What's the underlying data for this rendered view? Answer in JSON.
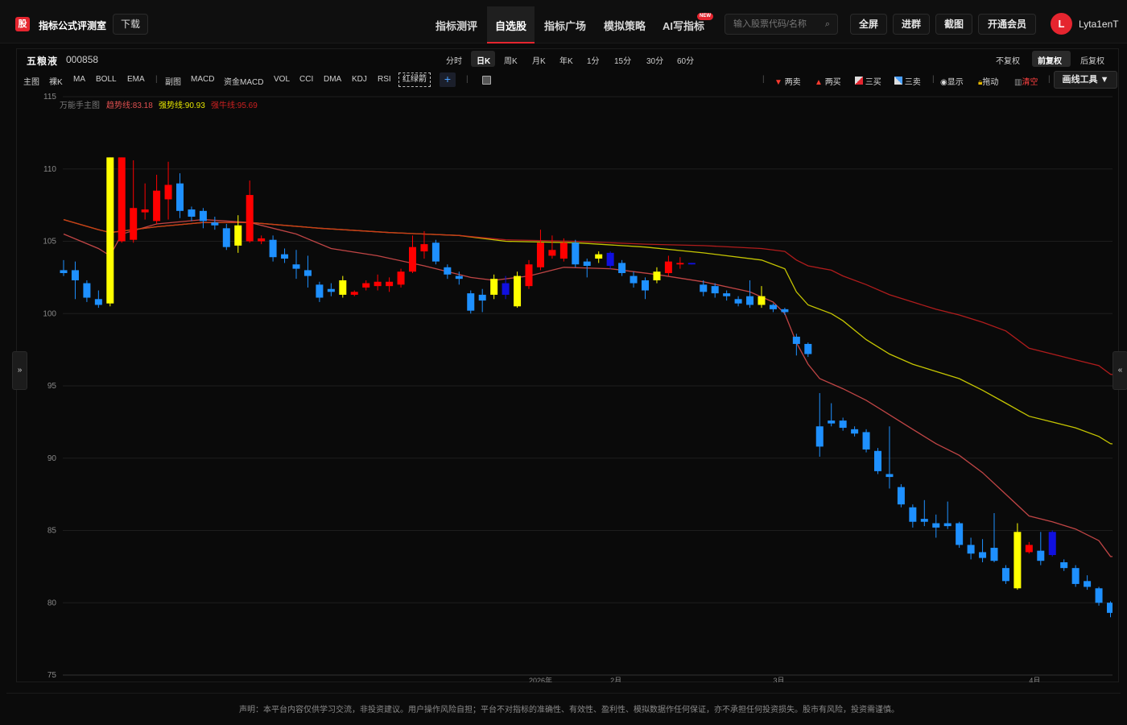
{
  "header": {
    "logo_char": "股",
    "brand": "指标公式评测室",
    "download_label": "下载",
    "nav": [
      "指标测评",
      "自选股",
      "指标广场",
      "模拟策略",
      "AI写指标"
    ],
    "nav_active": "自选股",
    "new_badge": "NEW",
    "search_placeholder": "输入股票代码/名称",
    "buttons": [
      "全屏",
      "进群",
      "截图",
      "开通会员"
    ],
    "avatar_letter": "L",
    "username": "Lyta1enT"
  },
  "stock": {
    "name": "五粮液",
    "code": "000858"
  },
  "periods": [
    "分时",
    "日K",
    "周K",
    "月K",
    "年K",
    "1分",
    "15分",
    "30分",
    "60分"
  ],
  "period_active": "日K",
  "adjust": [
    "不复权",
    "前复权",
    "后复权"
  ],
  "adjust_active": "前复权",
  "indicators": [
    "主图",
    "裸K",
    "MA",
    "BOLL",
    "EMA",
    "副图",
    "MACD",
    "资金MACD",
    "VOL",
    "CCI",
    "DMA",
    "KDJ",
    "RSI"
  ],
  "indicator_selected": "红绿箭",
  "tools": [
    "两卖",
    "两买",
    "三买",
    "三卖",
    "显示",
    "拖动",
    "清空"
  ],
  "draw_tools_label": "画线工具 ▼",
  "side_left": "»",
  "side_right": "«",
  "footer": "声明：本平台内容仅供学习交流，非投资建议。用户操作风险自担；平台不对指标的准确性、有效性、盈利性、模拟数据作任何保证，亦不承担任何投资损失。股市有风险，投资需谨慎。",
  "colors": {
    "up": "#ff0000",
    "down": "#1e90ff",
    "signal": "#ffff00",
    "dark_blue": "#1010e0",
    "accent": "#e5252f"
  },
  "chart_data": {
    "type": "candlestick",
    "legend": [
      {
        "name": "万能手主图",
        "value": "",
        "color": "#777777"
      },
      {
        "name": "趋势线",
        "value": "83.18",
        "color": "#e05050"
      },
      {
        "name": "强势线",
        "value": "90.93",
        "color": "#e6e600"
      },
      {
        "name": "强牛线",
        "value": "95.69",
        "color": "#cc2020"
      }
    ],
    "ylim": [
      75,
      115
    ],
    "y_ticks": [
      75,
      80,
      85,
      90,
      95,
      100,
      105,
      110,
      115
    ],
    "x_labels": [
      {
        "index": 40,
        "label": "2026年"
      },
      {
        "index": 47,
        "label": "2月"
      },
      {
        "index": 61,
        "label": "3月"
      },
      {
        "index": 83,
        "label": "4月"
      }
    ],
    "candles": [
      {
        "o": 103.0,
        "c": 102.8,
        "h": 103.7,
        "l": 102.6,
        "t": "down"
      },
      {
        "o": 103.0,
        "c": 102.3,
        "h": 103.6,
        "l": 101.0,
        "t": "down"
      },
      {
        "o": 102.1,
        "c": 101.1,
        "h": 102.3,
        "l": 100.8,
        "t": "down"
      },
      {
        "o": 101.0,
        "c": 100.6,
        "h": 101.6,
        "l": 100.4,
        "t": "down"
      },
      {
        "o": 100.7,
        "c": 110.8,
        "h": 110.8,
        "l": 100.5,
        "t": "signal"
      },
      {
        "o": 105.0,
        "c": 110.8,
        "h": 110.8,
        "l": 104.9,
        "t": "up"
      },
      {
        "o": 105.1,
        "c": 107.3,
        "h": 110.6,
        "l": 104.9,
        "t": "up"
      },
      {
        "o": 107.0,
        "c": 107.2,
        "h": 109.0,
        "l": 106.5,
        "t": "up"
      },
      {
        "o": 106.4,
        "c": 108.5,
        "h": 109.6,
        "l": 106.2,
        "t": "up"
      },
      {
        "o": 107.9,
        "c": 108.9,
        "h": 110.5,
        "l": 106.5,
        "t": "up"
      },
      {
        "o": 109.0,
        "c": 107.1,
        "h": 109.7,
        "l": 106.6,
        "t": "down"
      },
      {
        "o": 107.2,
        "c": 106.7,
        "h": 107.4,
        "l": 106.4,
        "t": "down"
      },
      {
        "o": 107.1,
        "c": 106.4,
        "h": 107.3,
        "l": 105.9,
        "t": "down"
      },
      {
        "o": 106.3,
        "c": 106.1,
        "h": 106.7,
        "l": 105.8,
        "t": "down"
      },
      {
        "o": 105.9,
        "c": 104.6,
        "h": 106.2,
        "l": 104.4,
        "t": "down"
      },
      {
        "o": 104.7,
        "c": 106.1,
        "h": 106.8,
        "l": 104.2,
        "t": "signal"
      },
      {
        "o": 105.0,
        "c": 108.2,
        "h": 109.2,
        "l": 104.9,
        "t": "up"
      },
      {
        "o": 105.2,
        "c": 105.0,
        "h": 105.4,
        "l": 104.8,
        "t": "up"
      },
      {
        "o": 105.1,
        "c": 103.9,
        "h": 105.4,
        "l": 103.6,
        "t": "down"
      },
      {
        "o": 104.1,
        "c": 103.8,
        "h": 104.5,
        "l": 103.5,
        "t": "down"
      },
      {
        "o": 103.4,
        "c": 103.1,
        "h": 104.4,
        "l": 102.4,
        "t": "down"
      },
      {
        "o": 103.0,
        "c": 102.6,
        "h": 104.0,
        "l": 101.8,
        "t": "down"
      },
      {
        "o": 102.0,
        "c": 101.1,
        "h": 102.2,
        "l": 100.8,
        "t": "down"
      },
      {
        "o": 101.7,
        "c": 101.5,
        "h": 102.1,
        "l": 101.2,
        "t": "down"
      },
      {
        "o": 101.3,
        "c": 102.3,
        "h": 102.6,
        "l": 101.1,
        "t": "signal"
      },
      {
        "o": 101.5,
        "c": 101.3,
        "h": 101.6,
        "l": 101.2,
        "t": "up"
      },
      {
        "o": 101.8,
        "c": 102.1,
        "h": 102.3,
        "l": 101.6,
        "t": "up"
      },
      {
        "o": 101.9,
        "c": 102.2,
        "h": 102.7,
        "l": 101.6,
        "t": "up"
      },
      {
        "o": 101.9,
        "c": 102.2,
        "h": 102.5,
        "l": 101.5,
        "t": "up"
      },
      {
        "o": 102.0,
        "c": 102.9,
        "h": 103.1,
        "l": 101.8,
        "t": "up"
      },
      {
        "o": 102.9,
        "c": 104.6,
        "h": 105.4,
        "l": 102.8,
        "t": "up"
      },
      {
        "o": 104.3,
        "c": 104.8,
        "h": 105.7,
        "l": 103.8,
        "t": "up"
      },
      {
        "o": 104.9,
        "c": 103.6,
        "h": 105.1,
        "l": 103.4,
        "t": "down"
      },
      {
        "o": 103.2,
        "c": 102.7,
        "h": 103.4,
        "l": 102.4,
        "t": "down"
      },
      {
        "o": 102.6,
        "c": 102.4,
        "h": 102.9,
        "l": 102.0,
        "t": "down"
      },
      {
        "o": 101.4,
        "c": 100.2,
        "h": 101.6,
        "l": 100.0,
        "t": "down"
      },
      {
        "o": 101.3,
        "c": 100.9,
        "h": 101.7,
        "l": 100.1,
        "t": "down"
      },
      {
        "o": 101.3,
        "c": 102.4,
        "h": 102.7,
        "l": 101.0,
        "t": "signal"
      },
      {
        "o": 101.3,
        "c": 102.1,
        "h": 102.6,
        "l": 101.0,
        "t": "dark_blue"
      },
      {
        "o": 100.5,
        "c": 102.6,
        "h": 102.9,
        "l": 100.4,
        "t": "signal"
      },
      {
        "o": 101.9,
        "c": 103.4,
        "h": 103.7,
        "l": 101.7,
        "t": "up"
      },
      {
        "o": 103.2,
        "c": 104.9,
        "h": 105.8,
        "l": 103.0,
        "t": "up"
      },
      {
        "o": 104.0,
        "c": 104.4,
        "h": 105.4,
        "l": 103.8,
        "t": "up"
      },
      {
        "o": 103.8,
        "c": 104.9,
        "h": 105.2,
        "l": 103.6,
        "t": "up"
      },
      {
        "o": 104.9,
        "c": 103.4,
        "h": 105.1,
        "l": 103.2,
        "t": "down"
      },
      {
        "o": 103.6,
        "c": 103.3,
        "h": 103.8,
        "l": 102.5,
        "t": "down"
      },
      {
        "o": 104.1,
        "c": 103.8,
        "h": 104.3,
        "l": 103.5,
        "t": "signal"
      },
      {
        "o": 103.3,
        "c": 104.2,
        "h": 104.3,
        "l": 103.1,
        "t": "dark_blue"
      },
      {
        "o": 103.5,
        "c": 102.8,
        "h": 103.7,
        "l": 102.6,
        "t": "down"
      },
      {
        "o": 102.6,
        "c": 102.1,
        "h": 102.9,
        "l": 101.8,
        "t": "down"
      },
      {
        "o": 102.3,
        "c": 101.6,
        "h": 102.5,
        "l": 101.0,
        "t": "down"
      },
      {
        "o": 102.3,
        "c": 102.9,
        "h": 103.2,
        "l": 102.1,
        "t": "signal"
      },
      {
        "o": 102.8,
        "c": 103.6,
        "h": 104.0,
        "l": 102.6,
        "t": "up"
      },
      {
        "o": 103.4,
        "c": 103.5,
        "h": 103.9,
        "l": 103.1,
        "t": "up"
      },
      {
        "o": 103.4,
        "c": 103.5,
        "h": 103.5,
        "l": 103.4,
        "t": "dark_blue"
      },
      {
        "o": 102.0,
        "c": 101.5,
        "h": 102.3,
        "l": 101.2,
        "t": "down"
      },
      {
        "o": 101.9,
        "c": 101.4,
        "h": 102.1,
        "l": 101.1,
        "t": "down"
      },
      {
        "o": 101.4,
        "c": 101.2,
        "h": 101.6,
        "l": 100.9,
        "t": "down"
      },
      {
        "o": 101.0,
        "c": 100.7,
        "h": 101.2,
        "l": 100.5,
        "t": "down"
      },
      {
        "o": 101.2,
        "c": 100.6,
        "h": 102.3,
        "l": 100.4,
        "t": "down"
      },
      {
        "o": 100.6,
        "c": 101.2,
        "h": 101.9,
        "l": 100.4,
        "t": "signal"
      },
      {
        "o": 100.6,
        "c": 100.3,
        "h": 100.7,
        "l": 100.1,
        "t": "down"
      },
      {
        "o": 100.3,
        "c": 100.1,
        "h": 100.4,
        "l": 99.9,
        "t": "down"
      },
      {
        "o": 98.4,
        "c": 97.9,
        "h": 98.6,
        "l": 97.1,
        "t": "down"
      },
      {
        "o": 97.9,
        "c": 97.2,
        "h": 98.0,
        "l": 97.0,
        "t": "down"
      },
      {
        "o": 92.2,
        "c": 90.8,
        "h": 94.5,
        "l": 90.1,
        "t": "down"
      },
      {
        "o": 92.6,
        "c": 92.4,
        "h": 93.8,
        "l": 92.2,
        "t": "down"
      },
      {
        "o": 92.6,
        "c": 92.1,
        "h": 92.8,
        "l": 91.9,
        "t": "down"
      },
      {
        "o": 92.0,
        "c": 91.7,
        "h": 92.2,
        "l": 91.5,
        "t": "down"
      },
      {
        "o": 91.8,
        "c": 90.6,
        "h": 92.0,
        "l": 90.4,
        "t": "down"
      },
      {
        "o": 90.5,
        "c": 89.1,
        "h": 90.7,
        "l": 88.9,
        "t": "down"
      },
      {
        "o": 88.9,
        "c": 88.7,
        "h": 92.2,
        "l": 87.9,
        "t": "down"
      },
      {
        "o": 88.0,
        "c": 86.8,
        "h": 88.2,
        "l": 86.6,
        "t": "down"
      },
      {
        "o": 86.6,
        "c": 85.6,
        "h": 86.8,
        "l": 85.2,
        "t": "down"
      },
      {
        "o": 85.8,
        "c": 85.6,
        "h": 87.1,
        "l": 85.3,
        "t": "down"
      },
      {
        "o": 85.5,
        "c": 85.2,
        "h": 86.1,
        "l": 84.5,
        "t": "down"
      },
      {
        "o": 85.5,
        "c": 85.3,
        "h": 87.0,
        "l": 85.1,
        "t": "down"
      },
      {
        "o": 85.5,
        "c": 84.0,
        "h": 85.6,
        "l": 83.8,
        "t": "down"
      },
      {
        "o": 84.0,
        "c": 83.4,
        "h": 84.5,
        "l": 83.0,
        "t": "down"
      },
      {
        "o": 83.5,
        "c": 83.1,
        "h": 84.4,
        "l": 82.8,
        "t": "down"
      },
      {
        "o": 83.8,
        "c": 82.9,
        "h": 86.2,
        "l": 82.8,
        "t": "down"
      },
      {
        "o": 82.4,
        "c": 81.5,
        "h": 82.6,
        "l": 81.3,
        "t": "down"
      },
      {
        "o": 81.0,
        "c": 84.9,
        "h": 85.5,
        "l": 80.9,
        "t": "signal"
      },
      {
        "o": 83.5,
        "c": 84.0,
        "h": 84.2,
        "l": 83.4,
        "t": "up"
      },
      {
        "o": 83.6,
        "c": 82.9,
        "h": 84.9,
        "l": 82.6,
        "t": "down"
      },
      {
        "o": 83.3,
        "c": 84.9,
        "h": 85.0,
        "l": 83.2,
        "t": "dark_blue"
      },
      {
        "o": 82.8,
        "c": 82.4,
        "h": 83.0,
        "l": 82.2,
        "t": "down"
      },
      {
        "o": 82.4,
        "c": 81.3,
        "h": 82.6,
        "l": 81.1,
        "t": "down"
      },
      {
        "o": 81.5,
        "c": 81.1,
        "h": 81.9,
        "l": 80.9,
        "t": "down"
      },
      {
        "o": 81.0,
        "c": 80.0,
        "h": 81.1,
        "l": 79.8,
        "t": "down"
      },
      {
        "o": 80.0,
        "c": 79.3,
        "h": 80.1,
        "l": 79.0,
        "t": "down"
      },
      {
        "o": 79.3,
        "c": 79.1,
        "h": 79.5,
        "l": 78.8,
        "t": "down"
      },
      {
        "o": 78.9,
        "c": 78.2,
        "h": 79.3,
        "l": 78.0,
        "t": "down"
      }
    ],
    "lines": [
      {
        "name": "趋势线",
        "color": "#e05050",
        "points": [
          [
            0,
            105.5
          ],
          [
            3,
            104.5
          ],
          [
            4,
            104.0
          ],
          [
            5,
            105.5
          ],
          [
            8,
            106.2
          ],
          [
            12,
            106.5
          ],
          [
            16,
            106.3
          ],
          [
            20,
            105.5
          ],
          [
            23,
            104.5
          ],
          [
            27,
            104.0
          ],
          [
            31,
            103.3
          ],
          [
            35,
            102.5
          ],
          [
            37,
            102.3
          ],
          [
            40,
            102.6
          ],
          [
            43,
            103.2
          ],
          [
            47,
            103.1
          ],
          [
            51,
            102.7
          ],
          [
            55,
            102.2
          ],
          [
            59,
            101.5
          ],
          [
            61,
            100.8
          ],
          [
            62,
            100.0
          ],
          [
            63,
            98.0
          ],
          [
            64,
            96.5
          ],
          [
            65,
            95.5
          ],
          [
            67,
            94.8
          ],
          [
            69,
            94.0
          ],
          [
            71,
            93.0
          ],
          [
            73,
            92.0
          ],
          [
            75,
            91.0
          ],
          [
            77,
            90.2
          ],
          [
            79,
            89.0
          ],
          [
            81,
            87.5
          ],
          [
            83,
            86.0
          ],
          [
            85,
            85.6
          ],
          [
            87,
            85.1
          ],
          [
            89,
            84.3
          ],
          [
            90,
            83.2
          ],
          [
            91,
            83.18
          ]
        ]
      },
      {
        "name": "强势线",
        "color": "#e6e600",
        "points": [
          [
            0,
            106.5
          ],
          [
            3,
            105.8
          ],
          [
            4,
            105.6
          ],
          [
            8,
            106.0
          ],
          [
            12,
            106.3
          ],
          [
            16,
            106.3
          ],
          [
            22,
            105.9
          ],
          [
            28,
            105.6
          ],
          [
            34,
            105.4
          ],
          [
            38,
            105.0
          ],
          [
            44,
            104.9
          ],
          [
            50,
            104.6
          ],
          [
            55,
            104.2
          ],
          [
            60,
            103.7
          ],
          [
            62,
            103.1
          ],
          [
            63,
            101.5
          ],
          [
            64,
            100.6
          ],
          [
            66,
            100.0
          ],
          [
            67,
            99.5
          ],
          [
            69,
            98.2
          ],
          [
            71,
            97.2
          ],
          [
            73,
            96.5
          ],
          [
            75,
            96.0
          ],
          [
            77,
            95.5
          ],
          [
            79,
            94.7
          ],
          [
            81,
            93.8
          ],
          [
            83,
            92.9
          ],
          [
            85,
            92.5
          ],
          [
            87,
            92.1
          ],
          [
            89,
            91.5
          ],
          [
            90,
            91.0
          ],
          [
            91,
            90.93
          ]
        ]
      },
      {
        "name": "强牛线",
        "color": "#cc2020",
        "points": [
          [
            0,
            106.5
          ],
          [
            3,
            105.8
          ],
          [
            4,
            105.6
          ],
          [
            8,
            106.0
          ],
          [
            12,
            106.3
          ],
          [
            16,
            106.3
          ],
          [
            22,
            105.9
          ],
          [
            28,
            105.6
          ],
          [
            34,
            105.4
          ],
          [
            38,
            105.1
          ],
          [
            44,
            105.0
          ],
          [
            50,
            104.8
          ],
          [
            55,
            104.7
          ],
          [
            60,
            104.5
          ],
          [
            62,
            104.3
          ],
          [
            63,
            103.7
          ],
          [
            64,
            103.3
          ],
          [
            66,
            103.0
          ],
          [
            67,
            102.6
          ],
          [
            69,
            102.0
          ],
          [
            71,
            101.3
          ],
          [
            73,
            100.8
          ],
          [
            75,
            100.3
          ],
          [
            77,
            99.9
          ],
          [
            79,
            99.4
          ],
          [
            81,
            98.8
          ],
          [
            83,
            97.6
          ],
          [
            85,
            97.2
          ],
          [
            87,
            96.8
          ],
          [
            89,
            96.4
          ],
          [
            90,
            95.8
          ],
          [
            91,
            95.69
          ]
        ]
      }
    ]
  }
}
